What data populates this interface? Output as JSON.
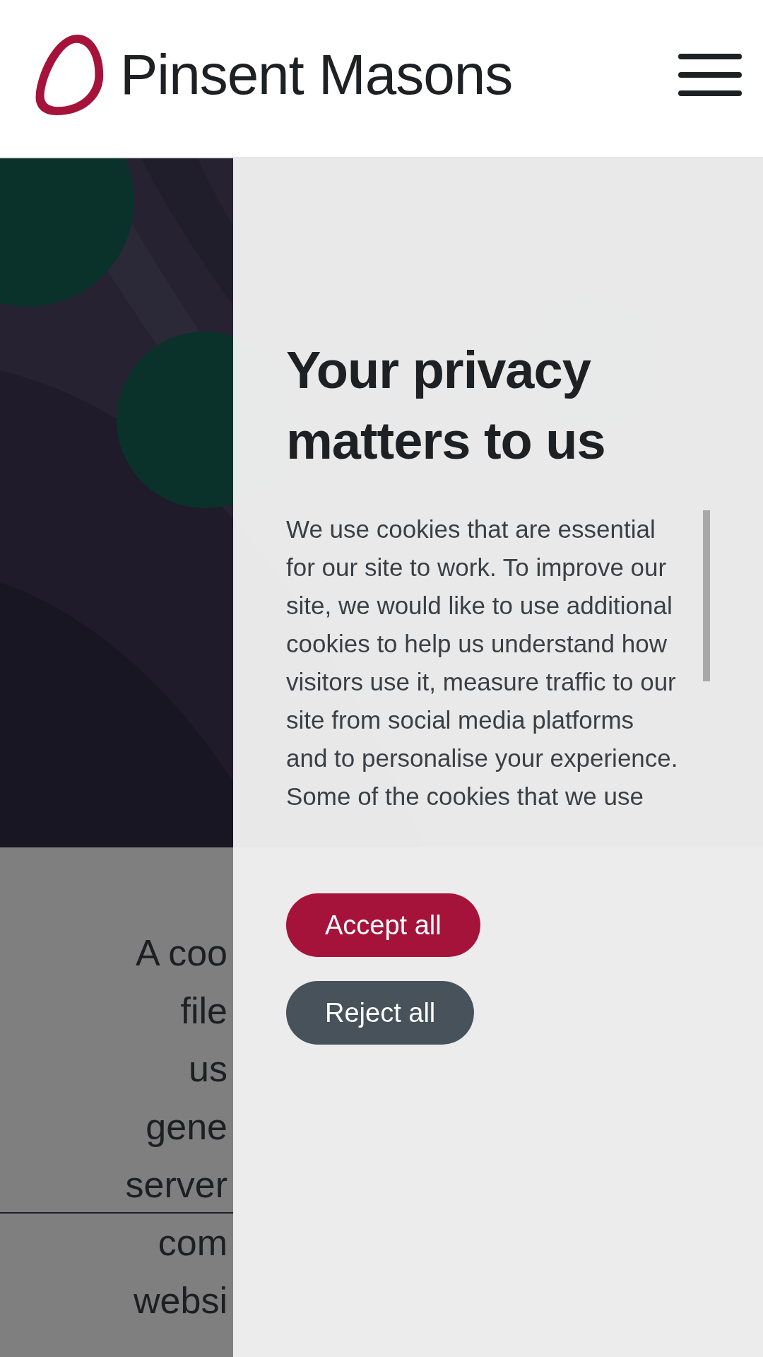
{
  "header": {
    "logo_text": "Pinsent Masons"
  },
  "page": {
    "paragraph_lines": [
      "A coo",
      "file",
      "us",
      "gene",
      "server",
      "com",
      "websi"
    ]
  },
  "cookie_panel": {
    "title": "Your privacy matters to us",
    "body": "We use cookies that are essential for our site to work. To improve our site, we would like to use additional cookies to help us understand how visitors use it, measure traffic to our site from social media platforms and to personalise your experience. Some of the cookies that we use",
    "buttons": [
      {
        "label": "Accept all",
        "kind": "primary"
      },
      {
        "label": "Reject all",
        "kind": "secondary"
      }
    ]
  }
}
